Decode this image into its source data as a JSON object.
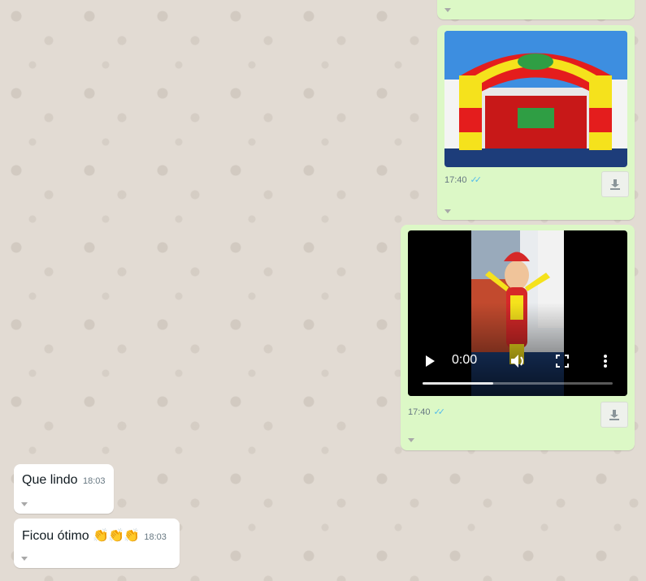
{
  "messages": {
    "m_image": {
      "time": "17:40",
      "ticks": "✓✓"
    },
    "m_video": {
      "time": "17:40",
      "ticks": "✓✓",
      "current_time": "0:00",
      "progress": 0.37
    },
    "m_text1": {
      "text": "Que lindo",
      "time": "18:03"
    },
    "m_text2": {
      "text": "Ficou ótimo",
      "emoji": "👏👏👏",
      "time": "18:03"
    }
  },
  "colors": {
    "outgoing": "#dcf8c6",
    "incoming": "#ffffff",
    "ticks": "#53bdeb"
  }
}
